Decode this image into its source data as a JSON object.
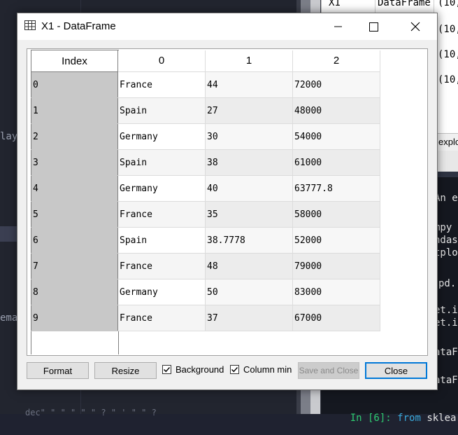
{
  "background": {
    "editor_fragments": [
      {
        "text": "lay"
      },
      {
        "text": "ema"
      },
      {
        "text": "dec\" \" \" \" \" \" ? \" ' \" \" ?"
      }
    ],
    "variable_explorer": {
      "rows": [
        {
          "name": "X1",
          "type": "DataFrame",
          "size": "(10,"
        },
        {
          "name": "",
          "type": "",
          "size": "(10,"
        },
        {
          "name": "",
          "type": "",
          "size": "(10,"
        },
        {
          "name": "",
          "type": "",
          "size": "(10,"
        }
      ],
      "tab_label": "explo"
    },
    "console": {
      "lines": [
        "An e",
        "",
        "mpy",
        "ndas",
        "tplo",
        "",
        "pd.",
        "",
        "et.i",
        "et.i",
        "",
        "ataF",
        "",
        "ataF"
      ],
      "prompt": "In [6]:",
      "keyword": "from",
      "rest": " sklearn."
    }
  },
  "dialog": {
    "title": "X1 - DataFrame",
    "index_header": "Index",
    "columns": [
      "0",
      "1",
      "2"
    ],
    "rows": [
      {
        "index": "0",
        "values": [
          "France",
          "44",
          "72000"
        ]
      },
      {
        "index": "1",
        "values": [
          "Spain",
          "27",
          "48000"
        ]
      },
      {
        "index": "2",
        "values": [
          "Germany",
          "30",
          "54000"
        ]
      },
      {
        "index": "3",
        "values": [
          "Spain",
          "38",
          "61000"
        ]
      },
      {
        "index": "4",
        "values": [
          "Germany",
          "40",
          "63777.8"
        ]
      },
      {
        "index": "5",
        "values": [
          "France",
          "35",
          "58000"
        ]
      },
      {
        "index": "6",
        "values": [
          "Spain",
          "38.7778",
          "52000"
        ]
      },
      {
        "index": "7",
        "values": [
          "France",
          "48",
          "79000"
        ]
      },
      {
        "index": "8",
        "values": [
          "Germany",
          "50",
          "83000"
        ]
      },
      {
        "index": "9",
        "values": [
          "France",
          "37",
          "67000"
        ]
      }
    ],
    "buttons": {
      "format": "Format",
      "resize": "Resize",
      "background": "Background",
      "column_min": "Column min",
      "save_and_close": "Save and Close",
      "close": "Close"
    },
    "checkboxes": {
      "background_checked": true,
      "column_min_checked": true
    }
  }
}
